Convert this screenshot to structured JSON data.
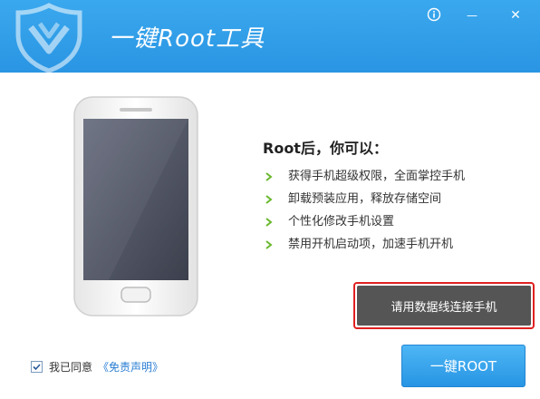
{
  "window": {
    "title": "一键Root工具",
    "info_icon": "info-icon",
    "minimize_label": "—",
    "close_label": "✕"
  },
  "main": {
    "headline": "Root后，你可以：",
    "features": [
      "获得手机超级权限，全面掌控手机",
      "卸载预装应用，释放存储空间",
      "个性化修改手机设置",
      "禁用开机启动项，加速手机开机"
    ],
    "toast": "请用数据线连接手机"
  },
  "footer": {
    "agree_label": "我已同意",
    "agree_checked": true,
    "disclaimer_link": "《免责声明》",
    "root_button": "一键ROOT"
  },
  "colors": {
    "titlebar": "#2a95e3",
    "accent": "#2795e4",
    "link": "#2a7ed3",
    "bullet": "#6ab82e",
    "toast_bg": "#555555",
    "toast_border": "#e02020"
  }
}
